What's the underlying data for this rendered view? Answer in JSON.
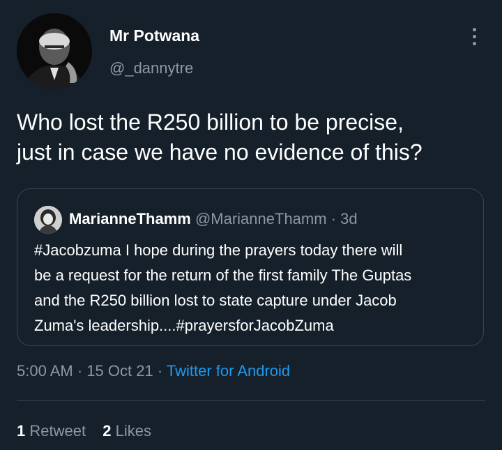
{
  "author": {
    "display_name": "Mr Potwana",
    "handle": "@_dannytre",
    "avatar_icon": "person-photo-avatar"
  },
  "tweet": {
    "text": "Who lost the R250 billion to be precise,\njust in case we have no evidence of this?"
  },
  "quoted_tweet": {
    "display_name": "MarianneThamm",
    "handle": "@MarianneThamm",
    "separator": "·",
    "time": "3d",
    "text": "#Jacobzuma I hope during the prayers today there will\nbe a request for the return of the first family The Guptas\nand the R250 billion lost to state capture under Jacob\nZuma's leadership....#prayersforJacobZuma"
  },
  "meta": {
    "time": "5:00 AM",
    "sep1": "·",
    "date": "15 Oct 21",
    "sep2": "·",
    "source": "Twitter for Android"
  },
  "stats": {
    "retweets_count": "1",
    "retweets_label": "Retweet",
    "likes_count": "2",
    "likes_label": "Likes"
  },
  "colors": {
    "background": "#15202b",
    "text_primary": "#ffffff",
    "text_secondary": "#8b98a5",
    "accent": "#1d9bf0",
    "border": "#38444d"
  }
}
